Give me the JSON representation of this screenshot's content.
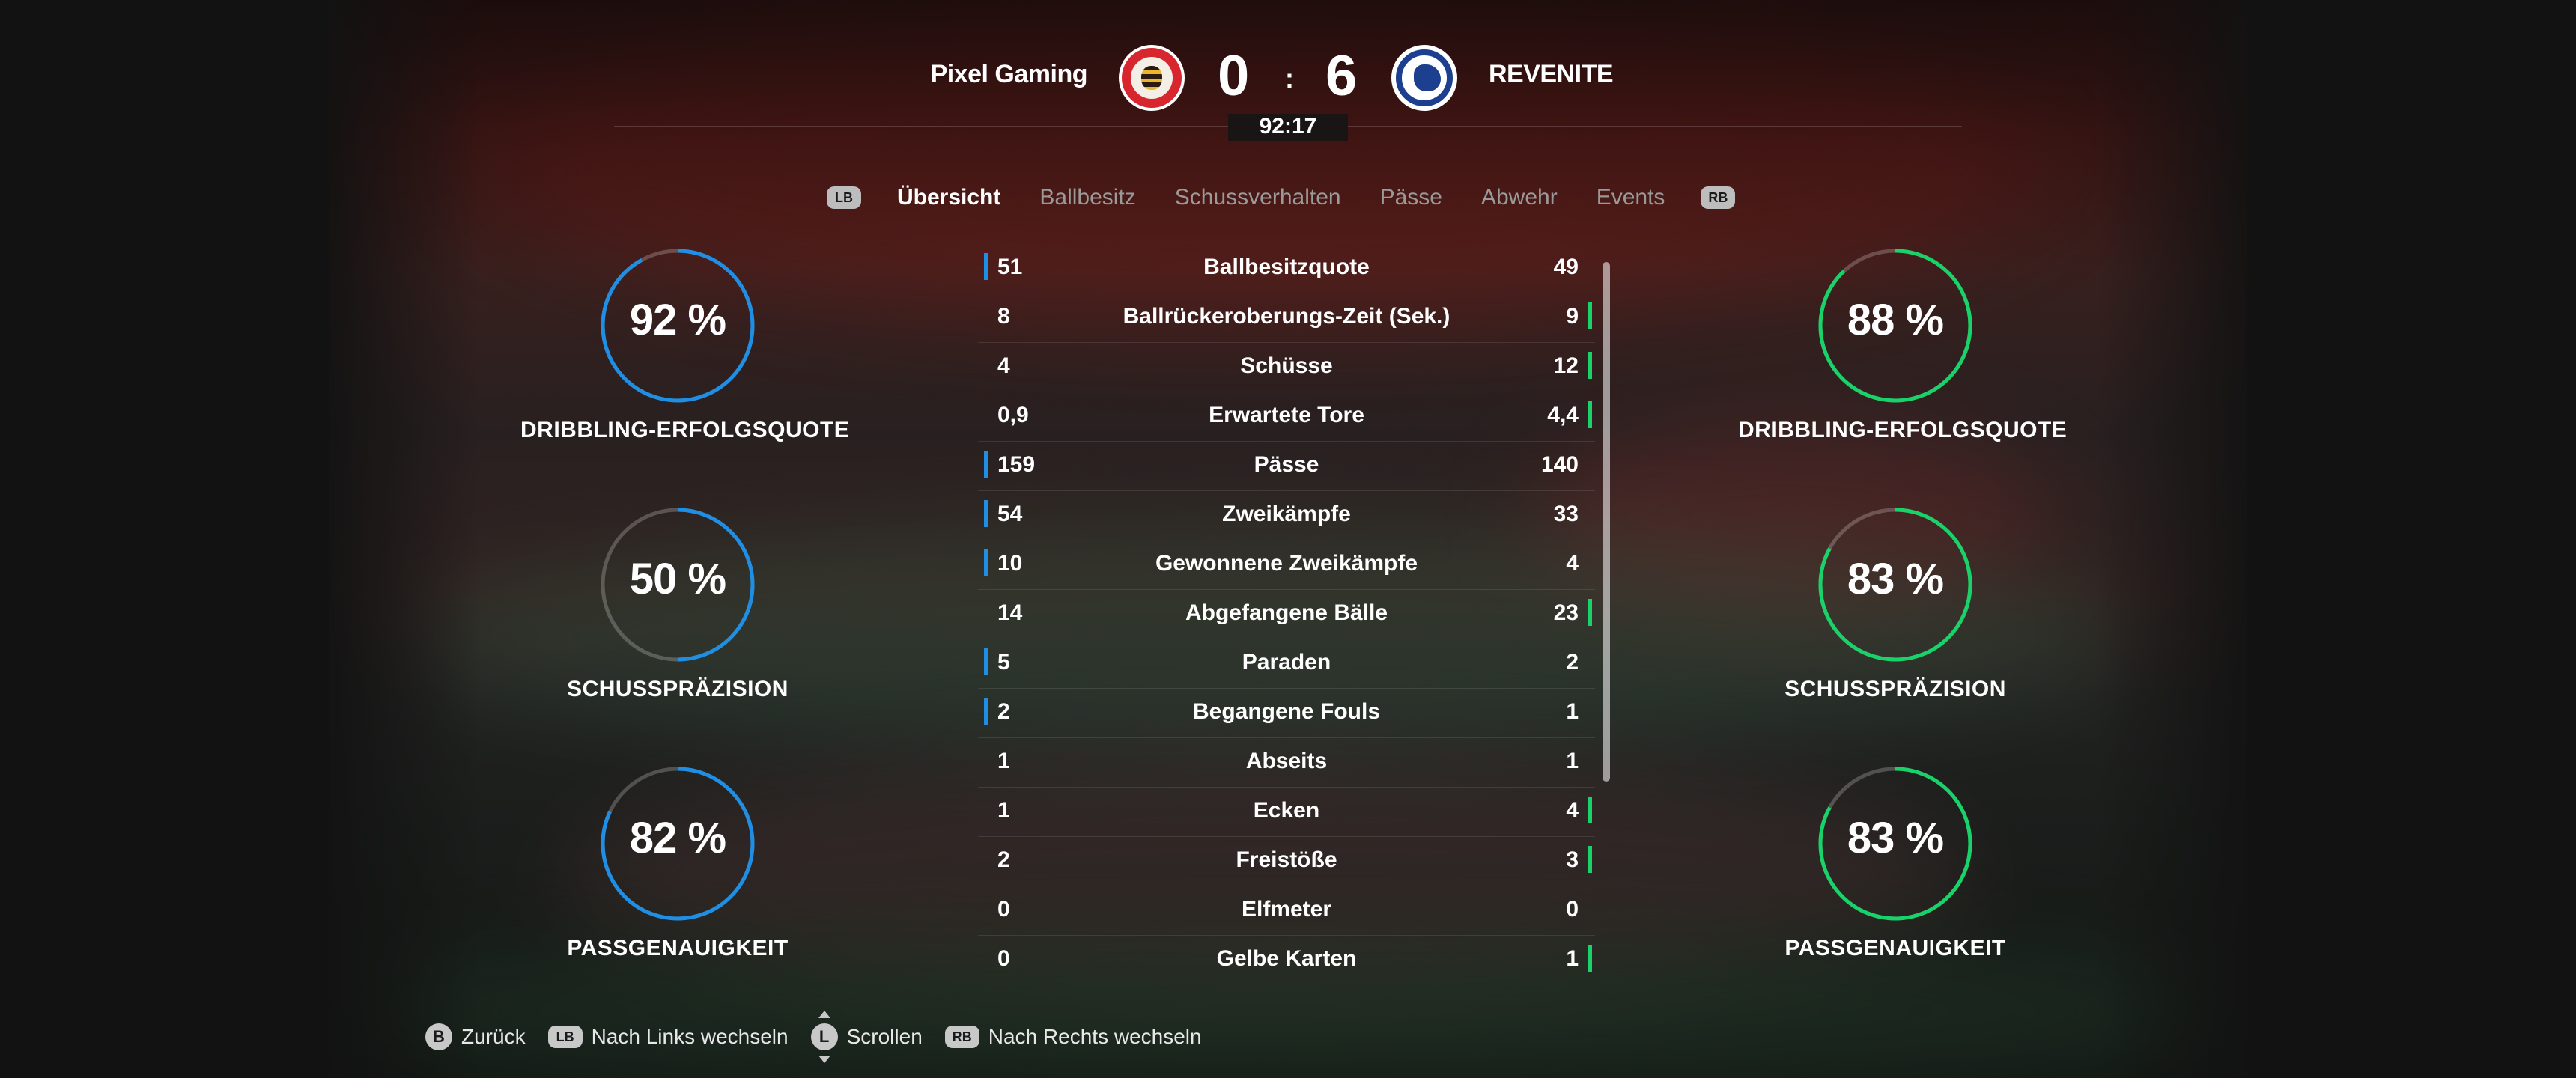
{
  "header": {
    "home_team": "Pixel Gaming",
    "away_team": "REVENITE",
    "home_score": "0",
    "away_score": "6",
    "separator": ":",
    "clock": "92:17"
  },
  "tabs": {
    "lb": "LB",
    "rb": "RB",
    "items": [
      "Übersicht",
      "Ballbesitz",
      "Schussverhalten",
      "Pässe",
      "Abwehr",
      "Events"
    ],
    "active_index": 0
  },
  "gauges": {
    "home": [
      {
        "label": "DRIBBLING-ERFOLGSQUOTE",
        "value_text": "92 %",
        "value": 92
      },
      {
        "label": "SCHUSSPRÄZISION",
        "value_text": "50 %",
        "value": 50
      },
      {
        "label": "PASSGENAUIGKEIT",
        "value_text": "82 %",
        "value": 82
      }
    ],
    "away": [
      {
        "label": "DRIBBLING-ERFOLGSQUOTE",
        "value_text": "88 %",
        "value": 88
      },
      {
        "label": "SCHUSSPRÄZISION",
        "value_text": "83 %",
        "value": 83
      },
      {
        "label": "PASSGENAUIGKEIT",
        "value_text": "83 %",
        "value": 83
      }
    ]
  },
  "stats": [
    {
      "name": "Ballbesitzquote",
      "home": "51",
      "away": "49",
      "leader": "home"
    },
    {
      "name": "Ballrückeroberungs-Zeit (Sek.)",
      "home": "8",
      "away": "9",
      "leader": "away"
    },
    {
      "name": "Schüsse",
      "home": "4",
      "away": "12",
      "leader": "away"
    },
    {
      "name": "Erwartete Tore",
      "home": "0,9",
      "away": "4,4",
      "leader": "away"
    },
    {
      "name": "Pässe",
      "home": "159",
      "away": "140",
      "leader": "home"
    },
    {
      "name": "Zweikämpfe",
      "home": "54",
      "away": "33",
      "leader": "home"
    },
    {
      "name": "Gewonnene Zweikämpfe",
      "home": "10",
      "away": "4",
      "leader": "home"
    },
    {
      "name": "Abgefangene Bälle",
      "home": "14",
      "away": "23",
      "leader": "away"
    },
    {
      "name": "Paraden",
      "home": "5",
      "away": "2",
      "leader": "home"
    },
    {
      "name": "Begangene Fouls",
      "home": "2",
      "away": "1",
      "leader": "home"
    },
    {
      "name": "Abseits",
      "home": "1",
      "away": "1",
      "leader": "none"
    },
    {
      "name": "Ecken",
      "home": "1",
      "away": "4",
      "leader": "away"
    },
    {
      "name": "Freistöße",
      "home": "2",
      "away": "3",
      "leader": "away"
    },
    {
      "name": "Elfmeter",
      "home": "0",
      "away": "0",
      "leader": "none"
    },
    {
      "name": "Gelbe Karten",
      "home": "0",
      "away": "1",
      "leader": "away"
    }
  ],
  "footer": {
    "back_key": "B",
    "back_label": "Zurück",
    "left_key": "LB",
    "left_label": "Nach Links wechseln",
    "scroll_key": "L",
    "scroll_label": "Scrollen",
    "right_key": "RB",
    "right_label": "Nach Rechts wechseln"
  },
  "colors": {
    "home_accent": "#1f8fe6",
    "away_accent": "#19d36a",
    "home_crest": "#d8262e",
    "away_crest": "#1d3f8f"
  }
}
